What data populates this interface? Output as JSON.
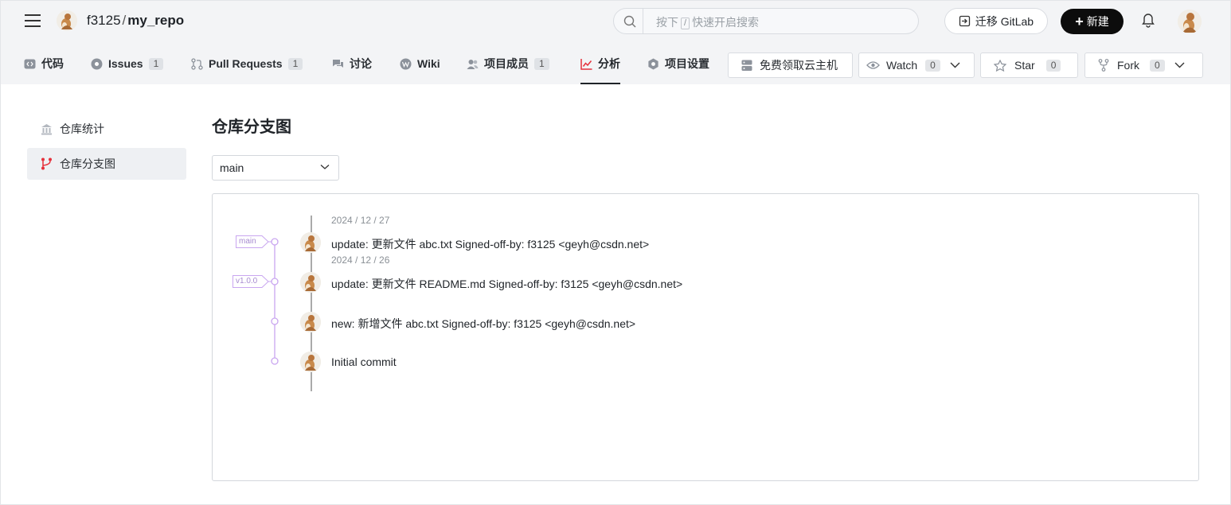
{
  "header": {
    "owner": "f3125",
    "separator": "/",
    "repo": "my_repo",
    "search": {
      "prefix": "按下",
      "key": "/",
      "suffix": "快速开启搜索"
    },
    "migrate_label": "迁移 GitLab",
    "new_label": "新建"
  },
  "nav": {
    "tabs": [
      {
        "label": "代码",
        "icon": "code-icon"
      },
      {
        "label": "Issues",
        "count": "1",
        "icon": "issue-icon"
      },
      {
        "label": "Pull Requests",
        "count": "1",
        "icon": "pull-request-icon"
      },
      {
        "label": "讨论",
        "icon": "discussion-icon"
      },
      {
        "label": "Wiki",
        "icon": "wiki-icon"
      },
      {
        "label": "项目成员",
        "count": "1",
        "icon": "members-icon"
      },
      {
        "label": "分析",
        "icon": "chart-icon",
        "active": true
      },
      {
        "label": "项目设置",
        "icon": "settings-icon"
      }
    ],
    "cloud_label": "免费领取云主机",
    "watch": {
      "label": "Watch",
      "count": "0"
    },
    "star": {
      "label": "Star",
      "count": "0"
    },
    "fork": {
      "label": "Fork",
      "count": "0"
    }
  },
  "sidebar": {
    "items": [
      {
        "label": "仓库统计",
        "icon": "repo-stats-icon",
        "active": false
      },
      {
        "label": "仓库分支图",
        "icon": "branch-graph-icon",
        "active": true
      }
    ]
  },
  "main": {
    "title": "仓库分支图",
    "branch_selected": "main"
  },
  "graph": {
    "commits": [
      {
        "date": "2024 / 12 / 27",
        "message": "update: 更新文件 abc.txt Signed-off-by: f3125 <geyh@csdn.net>",
        "ref": "main"
      },
      {
        "date": "2024 / 12 / 26",
        "message": "update: 更新文件 README.md Signed-off-by: f3125 <geyh@csdn.net>",
        "ref": "v1.0.0"
      },
      {
        "date": "",
        "message": "new: 新增文件 abc.txt Signed-off-by: f3125 <geyh@csdn.net>",
        "ref": ""
      },
      {
        "date": "",
        "message": "Initial commit",
        "ref": ""
      }
    ]
  },
  "colors": {
    "graph_line": "#c9a6f0",
    "accent_red": "#e5303b",
    "primary_black": "#0c0c0c"
  }
}
